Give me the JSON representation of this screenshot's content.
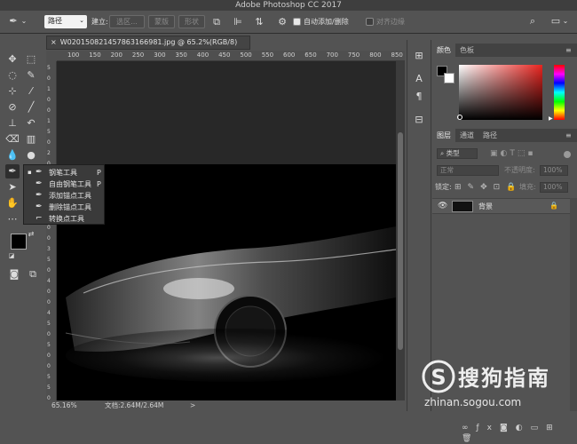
{
  "app": {
    "title": "Adobe Photoshop CC 2017"
  },
  "options_bar": {
    "mode_value": "路径",
    "build_label": "建立:",
    "selection_button": "选区...",
    "mask_button": "蒙版",
    "shape_button": "形状",
    "auto_add_delete_label": "自动添加/删除",
    "auto_add_delete_checked": true,
    "align_edges_label": "对齐边缘",
    "align_edges_checked": false
  },
  "document": {
    "tab_label": "W020150821457863166981.jpg @ 65.2%(RGB/8)",
    "close_glyph": "×",
    "ruler_ticks": [
      "100",
      "150",
      "200",
      "250",
      "300",
      "350",
      "400",
      "450",
      "500",
      "550",
      "600",
      "650",
      "700",
      "750",
      "800",
      "850"
    ],
    "vruler_ticks": [
      "5",
      "0",
      "1",
      "0",
      "0",
      "1",
      "5",
      "0",
      "2",
      "0",
      "0",
      "2",
      "5",
      "0",
      "3",
      "0",
      "0",
      "3",
      "5",
      "0",
      "4",
      "0",
      "0",
      "4",
      "5",
      "0",
      "5",
      "0",
      "0",
      "5",
      "5",
      "0"
    ]
  },
  "tool_flyout": {
    "items": [
      {
        "label": "钢笔工具",
        "key": "P",
        "selected": true
      },
      {
        "label": "自由钢笔工具",
        "key": "P",
        "selected": false
      },
      {
        "label": "添加锚点工具",
        "key": "",
        "selected": false
      },
      {
        "label": "删除锚点工具",
        "key": "",
        "selected": false
      },
      {
        "label": "转换点工具",
        "key": "",
        "selected": false
      }
    ]
  },
  "status_bar": {
    "zoom": "65.16%",
    "doc_size": "文档:2.64M/2.64M",
    "arrow": ">"
  },
  "color_panel": {
    "tabs": [
      "颜色",
      "色板"
    ],
    "foreground": "#000000",
    "background": "#ffffff"
  },
  "layers_panel": {
    "tabs": [
      "图层",
      "通道",
      "路径"
    ],
    "filter_label": "类型",
    "blend_mode": "正常",
    "opacity_label": "不透明度:",
    "opacity_value": "100%",
    "lock_label": "锁定:",
    "fill_label": "填充:",
    "fill_value": "100%",
    "layers": [
      {
        "name": "背景",
        "visible": true,
        "locked": true
      }
    ]
  },
  "watermark": {
    "brand": "搜狗指南",
    "url": "zhinan.sogou.com"
  },
  "colors": {
    "ui_bg": "#535353",
    "canvas_bg": "#282828",
    "accent_blue": "#2e7bd6"
  }
}
